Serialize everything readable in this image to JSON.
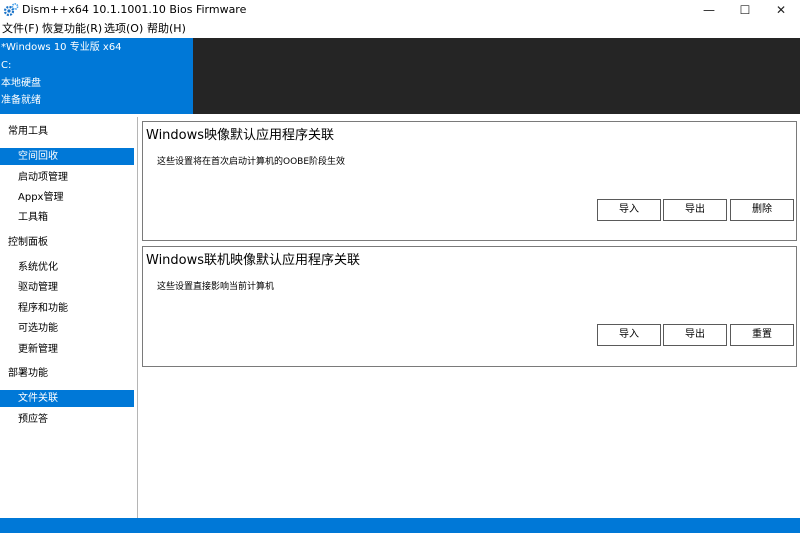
{
  "window": {
    "title": "Dism++x64 10.1.1001.10 Bios Firmware",
    "minimize_glyph": "—",
    "maximize_glyph": "☐",
    "close_glyph": "✕",
    "app_icon": "gear-icon"
  },
  "menu": {
    "items": [
      {
        "label": "文件(F)"
      },
      {
        "label": "恢复功能(R)"
      },
      {
        "label": "选项(O)"
      },
      {
        "label": "帮助(H)"
      }
    ]
  },
  "info": {
    "os": "*Windows 10 专业版 x64",
    "drive": "C:",
    "disk_type": "本地硬盘",
    "status": "准备就绪"
  },
  "sidebar": {
    "groups": [
      {
        "title": "常用工具",
        "items": [
          {
            "label": "空间回收",
            "active": true
          },
          {
            "label": "启动项管理"
          },
          {
            "label": "Appx管理"
          },
          {
            "label": "工具箱"
          }
        ]
      },
      {
        "title": "控制面板",
        "items": [
          {
            "label": "系统优化"
          },
          {
            "label": "驱动管理"
          },
          {
            "label": "程序和功能"
          },
          {
            "label": "可选功能"
          },
          {
            "label": "更新管理"
          }
        ]
      },
      {
        "title": "部署功能",
        "items": [
          {
            "label": "文件关联",
            "active": true
          },
          {
            "label": "预应答"
          }
        ]
      }
    ]
  },
  "cards": [
    {
      "title": "Windows映像默认应用程序关联",
      "description": "这些设置将在首次启动计算机的OOBE阶段生效",
      "buttons": [
        {
          "label": "导入"
        },
        {
          "label": "导出"
        },
        {
          "label": "删除"
        }
      ]
    },
    {
      "title": "Windows联机映像默认应用程序关联",
      "description": "这些设置直接影响当前计算机",
      "buttons": [
        {
          "label": "导入"
        },
        {
          "label": "导出"
        },
        {
          "label": "重置"
        }
      ]
    }
  ],
  "colors": {
    "accent": "#0078d7",
    "dark_panel": "#252525"
  }
}
